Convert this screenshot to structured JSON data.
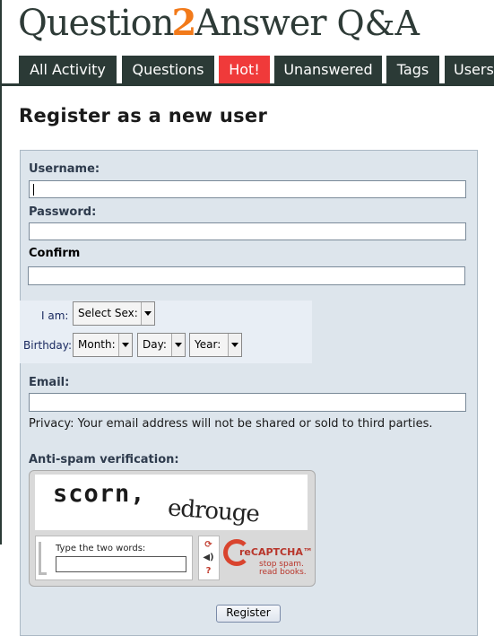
{
  "site": {
    "logo_word1": "Question",
    "logo_mark": "2",
    "logo_word2": "Answer",
    "logo_suffix": "Q&A"
  },
  "nav": {
    "tabs": [
      {
        "label": "All Activity"
      },
      {
        "label": "Questions"
      },
      {
        "label": "Hot!"
      },
      {
        "label": "Unanswered"
      },
      {
        "label": "Tags"
      },
      {
        "label": "Users"
      }
    ],
    "hot_color": "#f03a3a",
    "tab_color": "#2b3a36"
  },
  "page": {
    "title": "Register as a new user"
  },
  "form": {
    "username_label": "Username:",
    "username_value": "",
    "password_label": "Password:",
    "password_value": "",
    "confirm_label": "Confirm",
    "confirm_value": "",
    "iam_label": "I am:",
    "sex_select": "Select Sex:",
    "birthday_label": "Birthday:",
    "month_select": "Month:",
    "day_select": "Day:",
    "year_select": "Year:",
    "email_label": "Email:",
    "email_value": "",
    "privacy_text": "Privacy: Your email address will not be shared or sold to third parties.",
    "antispam_label": "Anti-spam verification:",
    "register_button": "Register"
  },
  "captcha": {
    "word1": "scorn,",
    "word2": "edrouge",
    "prompt": "Type the two words:",
    "brand": "reCAPTCHA™",
    "tagline1": "stop spam.",
    "tagline2": "read books.",
    "icons": [
      "refresh-icon",
      "audio-icon",
      "help-icon"
    ]
  }
}
